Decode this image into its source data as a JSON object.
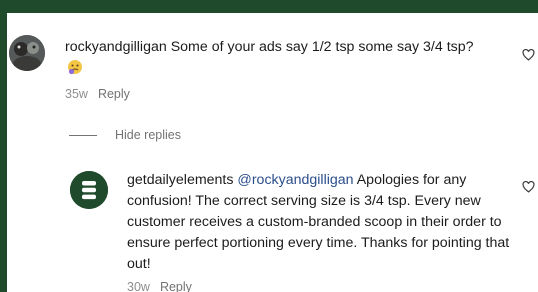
{
  "comment": {
    "username": "rockyandgilligan",
    "text": " Some of your ads say 1/2 tsp some say 3/4 tsp?",
    "age": "35w",
    "reply_label": "Reply"
  },
  "replies_toggle": {
    "label": "Hide replies"
  },
  "reply": {
    "username": "getdailyelements",
    "mention": "@rockyandgilligan",
    "text": " Apologies for any confusion! The correct serving size is 3/4 tsp. Every new customer receives a custom-branded scoop in their order to ensure perfect portioning every time. Thanks for pointing that out!",
    "age": "30w",
    "reply_label": "Reply"
  },
  "icons": {
    "avatar_1": "user-photo-avatar",
    "avatar_2": "brand-logo-avatar",
    "emoji": "thinking-face-emoji",
    "like": "heart-outline-icon"
  },
  "colors": {
    "frame": "#1f4a2c",
    "brand_avatar": "#1f4a2c",
    "mention": "#2b4e8c",
    "meta": "#8e8e8e"
  }
}
